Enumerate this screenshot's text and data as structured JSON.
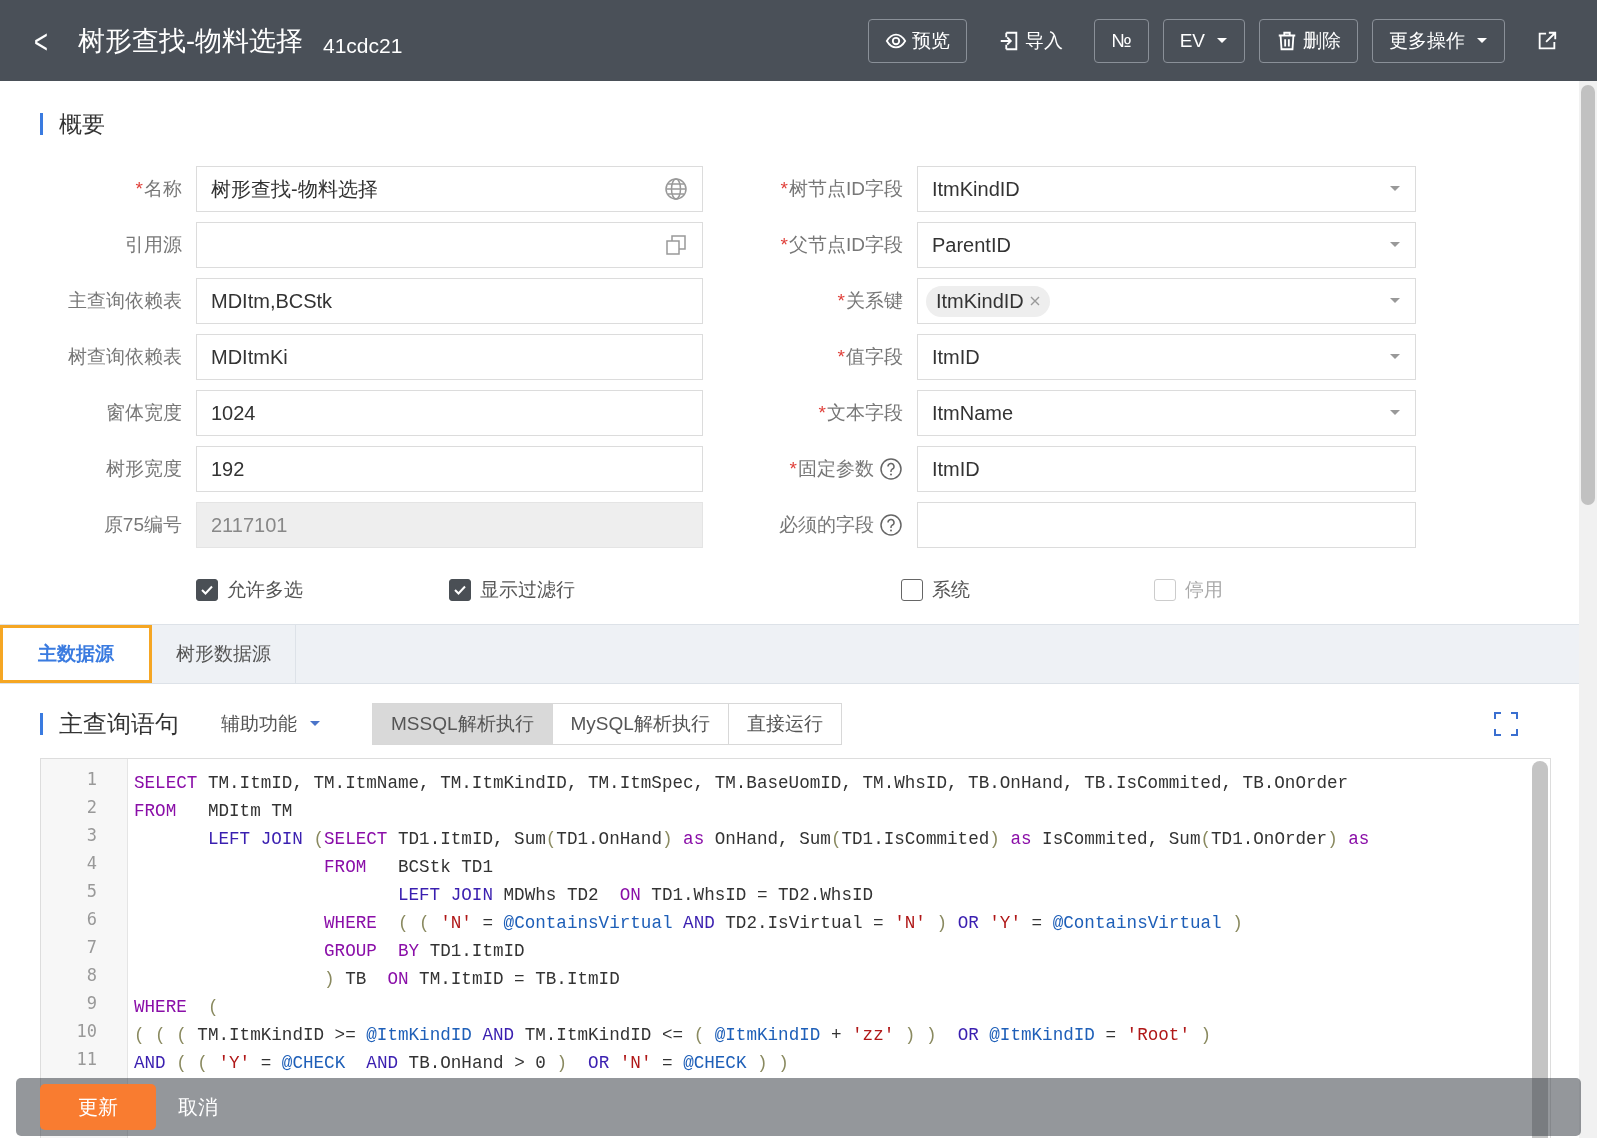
{
  "header": {
    "back_icon": "<",
    "title": "树形查找-物料选择",
    "code": "41cdc21",
    "actions": [
      {
        "kind": "eye",
        "label": "预览",
        "bordered": true
      },
      {
        "kind": "import",
        "label": "导入",
        "bordered": false
      },
      {
        "kind": "text",
        "label": "№",
        "bordered": true
      },
      {
        "kind": "dropdown",
        "label": "EV",
        "bordered": true
      },
      {
        "kind": "trash",
        "label": "删除",
        "bordered": true
      },
      {
        "kind": "dropdown",
        "label": "更多操作",
        "bordered": true
      },
      {
        "kind": "share",
        "bordered": false
      }
    ]
  },
  "summary": {
    "title": "概要",
    "left_fields": [
      {
        "marker": "*",
        "label": "名称",
        "kind": "multilingual",
        "value": "树形查找-物料选择",
        "disabled": false
      },
      {
        "label": "引用源",
        "kind": "lookup",
        "disabled": false
      },
      {
        "label": "主查询依赖表",
        "kind": "text",
        "value": "MDItm,BCStk",
        "disabled": false
      },
      {
        "label": "树查询依赖表",
        "kind": "text",
        "value": "MDItmKi",
        "disabled": false
      },
      {
        "label": "窗体宽度",
        "kind": "text",
        "value": "1024",
        "disabled": false
      },
      {
        "label": "树形宽度",
        "kind": "text",
        "value": "192",
        "disabled": false
      },
      {
        "label": "原75编号",
        "kind": "text",
        "value": "2117101",
        "disabled": true
      }
    ],
    "right_fields": [
      {
        "marker": "*",
        "label": "树节点ID字段",
        "kind": "select",
        "value": "ItmKindID",
        "help": false
      },
      {
        "marker": "*",
        "label": "父节点ID字段",
        "kind": "select",
        "value": "ParentID",
        "help": false
      },
      {
        "marker": "*",
        "label": "关系键",
        "kind": "tags",
        "value": "ItmKindID",
        "help": false
      },
      {
        "marker": "*",
        "label": "值字段",
        "kind": "select",
        "value": "ItmID",
        "help": false
      },
      {
        "marker": "*",
        "label": "文本字段",
        "kind": "select",
        "value": "ItmName",
        "help": false
      },
      {
        "marker": "*",
        "label": "固定参数",
        "kind": "text",
        "value": "ItmID",
        "help": true
      },
      {
        "label": "必须的字段",
        "kind": "text",
        "help": true
      }
    ],
    "checkboxes": [
      {
        "label": "允许多选",
        "checked": true,
        "disabled": false
      },
      {
        "label": "显示过滤行",
        "checked": true,
        "disabled": false
      },
      {
        "label": "系统",
        "checked": false,
        "disabled": false
      },
      {
        "label": "停用",
        "checked": false,
        "disabled": true
      }
    ]
  },
  "tabs": [
    {
      "label": "主数据源",
      "selected": true
    },
    {
      "label": "树形数据源",
      "selected": false
    }
  ],
  "query": {
    "title": "主查询语句",
    "helper": "辅助功能",
    "modes": [
      {
        "label": "MSSQL解析执行",
        "selected": true
      },
      {
        "label": "MySQL解析执行",
        "selected": false
      },
      {
        "label": "直接运行",
        "selected": false
      }
    ],
    "lines": [
      {
        "kind": "code",
        "number": "1",
        "tokens": [
          {
            "kind": "keyword",
            "text": "SELECT"
          },
          {
            "kind": "plain",
            "text": " TM.ItmID, TM.ItmName, TM.ItmKindID, TM.ItmSpec, TM.BaseUomID, TM.WhsID, TB.OnHand, TB.IsCommited, TB.OnOrder"
          }
        ]
      },
      {
        "kind": "code",
        "number": "2",
        "tokens": [
          {
            "kind": "keyword",
            "text": "FROM"
          },
          {
            "kind": "plain",
            "text": "   MDItm TM"
          }
        ]
      },
      {
        "kind": "code",
        "number": "3",
        "tokens": [
          {
            "kind": "operator",
            "text": "       LEFT JOIN "
          },
          {
            "kind": "paren",
            "text": "("
          },
          {
            "kind": "keyword",
            "text": "SELECT"
          },
          {
            "kind": "plain",
            "text": " TD1.ItmID, Sum"
          },
          {
            "kind": "paren",
            "text": "("
          },
          {
            "kind": "plain",
            "text": "TD1.OnHand"
          },
          {
            "kind": "paren",
            "text": ")"
          },
          {
            "kind": "keyword",
            "text": " as"
          },
          {
            "kind": "plain",
            "text": " OnHand, Sum"
          },
          {
            "kind": "paren",
            "text": "("
          },
          {
            "kind": "plain",
            "text": "TD1.IsCommited"
          },
          {
            "kind": "paren",
            "text": ")"
          },
          {
            "kind": "keyword",
            "text": " as"
          },
          {
            "kind": "plain",
            "text": " IsCommited, Sum"
          },
          {
            "kind": "paren",
            "text": "("
          },
          {
            "kind": "plain",
            "text": "TD1.OnOrder"
          },
          {
            "kind": "paren",
            "text": ")"
          },
          {
            "kind": "keyword",
            "text": " as"
          }
        ]
      },
      {
        "kind": "code",
        "number": "4",
        "tokens": [
          {
            "kind": "keyword",
            "text": "                  FROM"
          },
          {
            "kind": "plain",
            "text": "   BCStk TD1"
          }
        ]
      },
      {
        "kind": "code",
        "number": "5",
        "tokens": [
          {
            "kind": "operator",
            "text": "                         LEFT JOIN"
          },
          {
            "kind": "plain",
            "text": " MDWhs TD2  "
          },
          {
            "kind": "keyword",
            "text": "ON"
          },
          {
            "kind": "plain",
            "text": " TD1.WhsID = TD2.WhsID"
          }
        ]
      },
      {
        "kind": "code",
        "number": "6",
        "tokens": [
          {
            "kind": "keyword",
            "text": "                  WHERE"
          },
          {
            "kind": "paren",
            "text": "  ( ( "
          },
          {
            "kind": "string",
            "text": "'N'"
          },
          {
            "kind": "plain",
            "text": " = "
          },
          {
            "kind": "variable",
            "text": "@ContainsVirtual"
          },
          {
            "kind": "operator",
            "text": " AND"
          },
          {
            "kind": "plain",
            "text": " TD2.IsVirtual = "
          },
          {
            "kind": "string",
            "text": "'N'"
          },
          {
            "kind": "paren",
            "text": " ) "
          },
          {
            "kind": "operator",
            "text": "OR "
          },
          {
            "kind": "string",
            "text": "'Y'"
          },
          {
            "kind": "plain",
            "text": " = "
          },
          {
            "kind": "variable",
            "text": "@ContainsVirtual"
          },
          {
            "kind": "paren",
            "text": " )"
          }
        ]
      },
      {
        "kind": "code",
        "number": "7",
        "tokens": [
          {
            "kind": "keyword",
            "text": "                  GROUP  BY"
          },
          {
            "kind": "plain",
            "text": " TD1.ItmID"
          }
        ]
      },
      {
        "kind": "code",
        "number": "8",
        "tokens": [
          {
            "kind": "paren",
            "text": "                  )"
          },
          {
            "kind": "plain",
            "text": " TB  "
          },
          {
            "kind": "keyword",
            "text": "ON"
          },
          {
            "kind": "plain",
            "text": " TM.ItmID = TB.ItmID"
          }
        ]
      },
      {
        "kind": "code",
        "number": "9",
        "tokens": [
          {
            "kind": "keyword",
            "text": "WHERE"
          },
          {
            "kind": "paren",
            "text": "  ("
          }
        ]
      },
      {
        "kind": "code",
        "number": "10",
        "tokens": [
          {
            "kind": "paren",
            "text": "( ( ("
          },
          {
            "kind": "plain",
            "text": " TM.ItmKindID >= "
          },
          {
            "kind": "variable",
            "text": "@ItmKindID"
          },
          {
            "kind": "operator",
            "text": " AND"
          },
          {
            "kind": "plain",
            "text": " TM.ItmKindID <= "
          },
          {
            "kind": "paren",
            "text": "( "
          },
          {
            "kind": "variable",
            "text": "@ItmKindID"
          },
          {
            "kind": "plain",
            "text": " + "
          },
          {
            "kind": "string",
            "text": "'zz'"
          },
          {
            "kind": "paren",
            "text": " ) )  "
          },
          {
            "kind": "operator",
            "text": "OR "
          },
          {
            "kind": "variable",
            "text": "@ItmKindID"
          },
          {
            "kind": "plain",
            "text": " = "
          },
          {
            "kind": "string",
            "text": "'Root'"
          },
          {
            "kind": "paren",
            "text": " )"
          }
        ]
      },
      {
        "kind": "code",
        "number": "11",
        "tokens": [
          {
            "kind": "operator",
            "text": "AND"
          },
          {
            "kind": "paren",
            "text": " ( ( "
          },
          {
            "kind": "string",
            "text": "'Y'"
          },
          {
            "kind": "plain",
            "text": " = "
          },
          {
            "kind": "variable",
            "text": "@CHECK"
          },
          {
            "kind": "operator",
            "text": "  AND"
          },
          {
            "kind": "plain",
            "text": " TB.OnHand > 0 "
          },
          {
            "kind": "paren",
            "text": ")  "
          },
          {
            "kind": "operator",
            "text": "OR "
          },
          {
            "kind": "string",
            "text": "'N'"
          },
          {
            "kind": "plain",
            "text": " = "
          },
          {
            "kind": "variable",
            "text": "@CHECK"
          },
          {
            "kind": "paren",
            "text": " ) )"
          }
        ]
      }
    ]
  },
  "footer": {
    "buttons": [
      {
        "label": "更新",
        "kind": "primary"
      },
      {
        "label": "取消",
        "kind": "plain"
      }
    ]
  }
}
